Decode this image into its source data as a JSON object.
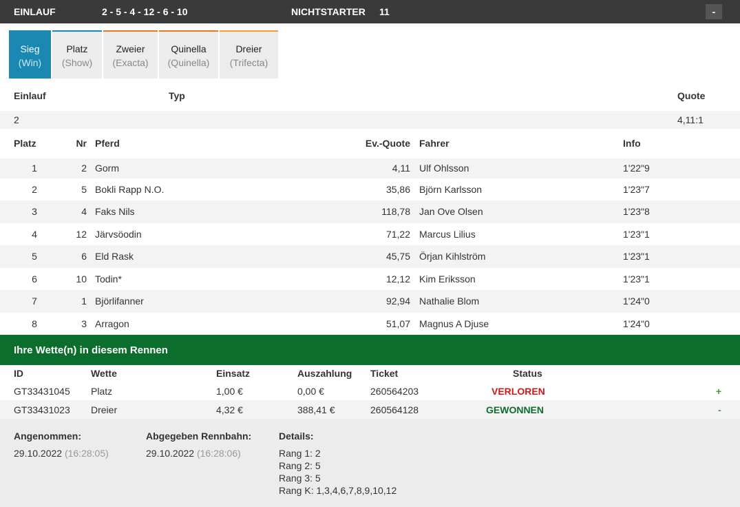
{
  "topbar": {
    "einlauf_label": "EINLAUF",
    "einlauf_value": "2 - 5 - 4 - 12 - 6 - 10",
    "nichtstarter_label": "NICHTSTARTER",
    "nichtstarter_value": "11",
    "collapse_label": "-"
  },
  "tabs": [
    {
      "label": "Sieg",
      "sub": "(Win)"
    },
    {
      "label": "Platz",
      "sub": "(Show)"
    },
    {
      "label": "Zweier",
      "sub": "(Exacta)"
    },
    {
      "label": "Quinella",
      "sub": "(Quinella)"
    },
    {
      "label": "Dreier",
      "sub": "(Trifecta)"
    }
  ],
  "summary": {
    "headers": {
      "einlauf": "Einlauf",
      "typ": "Typ",
      "quote": "Quote"
    },
    "row": {
      "einlauf": "2",
      "typ": "",
      "quote": "4,11:1"
    }
  },
  "results": {
    "headers": {
      "platz": "Platz",
      "nr": "Nr",
      "pferd": "Pferd",
      "quote": "Ev.-Quote",
      "fahrer": "Fahrer",
      "info": "Info"
    },
    "rows": [
      {
        "platz": "1",
        "nr": "2",
        "pferd": "Gorm",
        "quote": "4,11",
        "fahrer": "Ulf Ohlsson",
        "info": "1'22\"9"
      },
      {
        "platz": "2",
        "nr": "5",
        "pferd": "Bokli Rapp N.O.",
        "quote": "35,86",
        "fahrer": "Björn Karlsson",
        "info": "1'23\"7"
      },
      {
        "platz": "3",
        "nr": "4",
        "pferd": "Faks Nils",
        "quote": "118,78",
        "fahrer": "Jan Ove Olsen",
        "info": "1'23\"8"
      },
      {
        "platz": "4",
        "nr": "12",
        "pferd": "Järvsöodin",
        "quote": "71,22",
        "fahrer": "Marcus Lilius",
        "info": "1'23\"1"
      },
      {
        "platz": "5",
        "nr": "6",
        "pferd": "Eld Rask",
        "quote": "45,75",
        "fahrer": "Örjan Kihlström",
        "info": "1'23\"1"
      },
      {
        "platz": "6",
        "nr": "10",
        "pferd": "Todin*",
        "quote": "12,12",
        "fahrer": "Kim Eriksson",
        "info": "1'23\"1"
      },
      {
        "platz": "7",
        "nr": "1",
        "pferd": "Björlifanner",
        "quote": "92,94",
        "fahrer": "Nathalie Blom",
        "info": "1'24\"0"
      },
      {
        "platz": "8",
        "nr": "3",
        "pferd": "Arragon",
        "quote": "51,07",
        "fahrer": "Magnus A Djuse",
        "info": "1'24\"0"
      }
    ]
  },
  "bets": {
    "title": "Ihre Wette(n) in diesem Rennen",
    "headers": {
      "id": "ID",
      "wette": "Wette",
      "einsatz": "Einsatz",
      "auszahlung": "Auszahlung",
      "ticket": "Ticket",
      "status": "Status"
    },
    "rows": [
      {
        "id": "GT33431045",
        "wette": "Platz",
        "einsatz": "1,00 €",
        "auszahlung": "0,00 €",
        "ticket": "260564203",
        "status": "VERLOREN",
        "toggle": "+"
      },
      {
        "id": "GT33431023",
        "wette": "Dreier",
        "einsatz": "4,32 €",
        "auszahlung": "388,41 €",
        "ticket": "260564128",
        "status": "GEWONNEN",
        "toggle": "-"
      }
    ]
  },
  "details": {
    "angenommen_label": "Angenommen:",
    "angenommen_date": "29.10.2022",
    "angenommen_time": "(16:28:05)",
    "abgegeben_label": "Abgegeben Rennbahn:",
    "abgegeben_date": "29.10.2022",
    "abgegeben_time": "(16:28:06)",
    "details_label": "Details:",
    "lines": [
      "Rang 1: 2",
      "Rang 2: 5",
      "Rang 3: 5",
      "Rang K: 1,3,4,6,7,8,9,10,12"
    ]
  },
  "colors": {
    "tab_active": "#1a88b3",
    "bets_header": "#0b6e2c",
    "lost": "#d01818",
    "won": "#0b6e2c"
  }
}
